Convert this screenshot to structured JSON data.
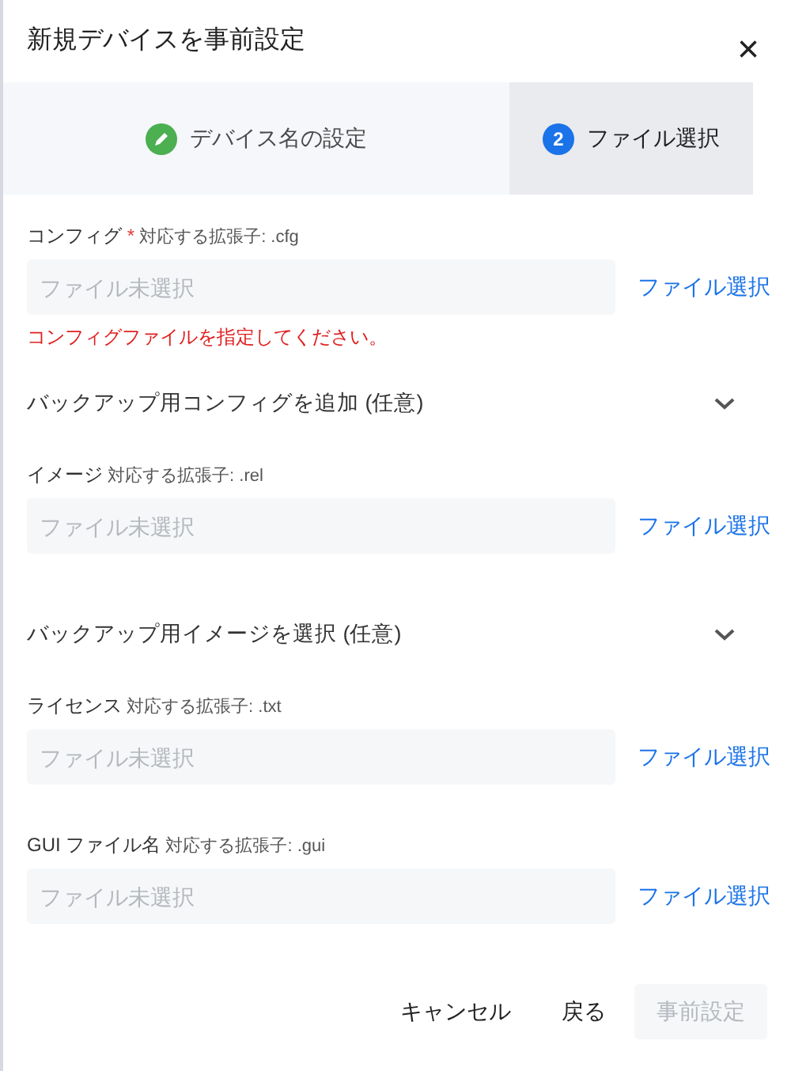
{
  "dialog": {
    "title": "新規デバイスを事前設定",
    "close": "×"
  },
  "steps": [
    {
      "label": "デバイス名の設定",
      "kind": "done",
      "selected": false
    },
    {
      "label": "ファイル選択",
      "kind": "numbered",
      "number": "2",
      "selected": true
    }
  ],
  "sections": [
    {
      "kind": "file",
      "name": "コンフィグ",
      "required": true,
      "required_mark": "*",
      "hint": "対応する拡張子: .cfg",
      "placeholder": "ファイル未選択",
      "button": "ファイル選択",
      "error": "コンフィグファイルを指定してください。"
    },
    {
      "kind": "collapsible",
      "label": "バックアップ用コンフィグを追加 (任意)",
      "expanded": false
    },
    {
      "kind": "file",
      "name": "イメージ",
      "required": false,
      "hint": "対応する拡張子: .rel",
      "placeholder": "ファイル未選択",
      "button": "ファイル選択"
    },
    {
      "kind": "collapsible",
      "label": "バックアップ用イメージを選択 (任意)",
      "expanded": false
    },
    {
      "kind": "file",
      "name": "ライセンス",
      "required": false,
      "hint": "対応する拡張子: .txt",
      "placeholder": "ファイル未選択",
      "button": "ファイル選択"
    },
    {
      "kind": "file",
      "name": "GUI ファイル名",
      "required": false,
      "hint": "対応する拡張子: .gui",
      "placeholder": "ファイル未選択",
      "button": "ファイル選択"
    }
  ],
  "footer": [
    {
      "label": "キャンセル",
      "disabled": false
    },
    {
      "label": "戻る",
      "disabled": false
    },
    {
      "label": "事前設定",
      "disabled": true
    }
  ]
}
